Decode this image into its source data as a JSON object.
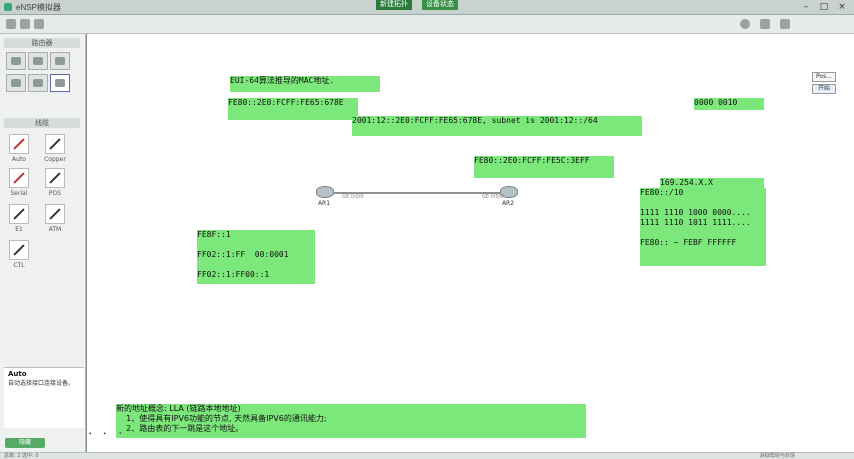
{
  "window": {
    "title": "eNSP模拟器",
    "notices": [
      "新建拓扑",
      "设备状态"
    ],
    "controls": [
      "–",
      "□",
      "×"
    ]
  },
  "left_panel": {
    "top_heading": "路由器",
    "cable_heading": "线缆",
    "cables": [
      {
        "label": "Auto"
      },
      {
        "label": "Copper"
      },
      {
        "label": "Serial"
      },
      {
        "label": "POS"
      },
      {
        "label": "E1"
      },
      {
        "label": "ATM"
      },
      {
        "label": "CTL"
      }
    ],
    "description": {
      "title": "Auto",
      "text": "自动选择接口连接设备。"
    },
    "bottom_button": "隐藏"
  },
  "canvas": {
    "notes": {
      "title": "EUI-64算法推导的MAC地址.",
      "fe80_left": "FE80::2E0:FCFF:FE65:678E",
      "binary_small": "0000 0010",
      "global": "2001:12::2E0:FCFF:FE65:678E, subnet is 2001:12::/64",
      "fe80_right": "FE80::2E0:FCFF:FE5C:3EFF",
      "link_local": "FE8F::1\n\nFF02::1:FF  00:0001\n\nFF02::1:FF00::1",
      "apipa": "169.254.X.X",
      "lla_range": "FE80::/10\n\n1111 1110 1000 0000....\n1111 1110 1011 1111....\n\nFE80:: ~ FEBF FFFFFF",
      "concept": "新的地址概念: LLA (链路本地地址)\n    1、使得具有IPV6功能的节点, 天然具备IPV6的通讯能力;\n    2、路由表的下一跳是这个地址。"
    },
    "routers": [
      {
        "label": "AR1"
      },
      {
        "label": "AR2"
      }
    ],
    "link_labels": [
      "GE 0/0/0",
      "GE 0/0/0"
    ],
    "side_buttons": [
      "Pos...",
      "开始"
    ]
  },
  "statusbar": {
    "left": "总数: 2  选中: 0",
    "right": "获取帮助与反馈"
  },
  "colors": {
    "note_bg": "#7ce87c",
    "canvas_bg": "#ffffff",
    "panel_bg": "#eef1ef"
  }
}
